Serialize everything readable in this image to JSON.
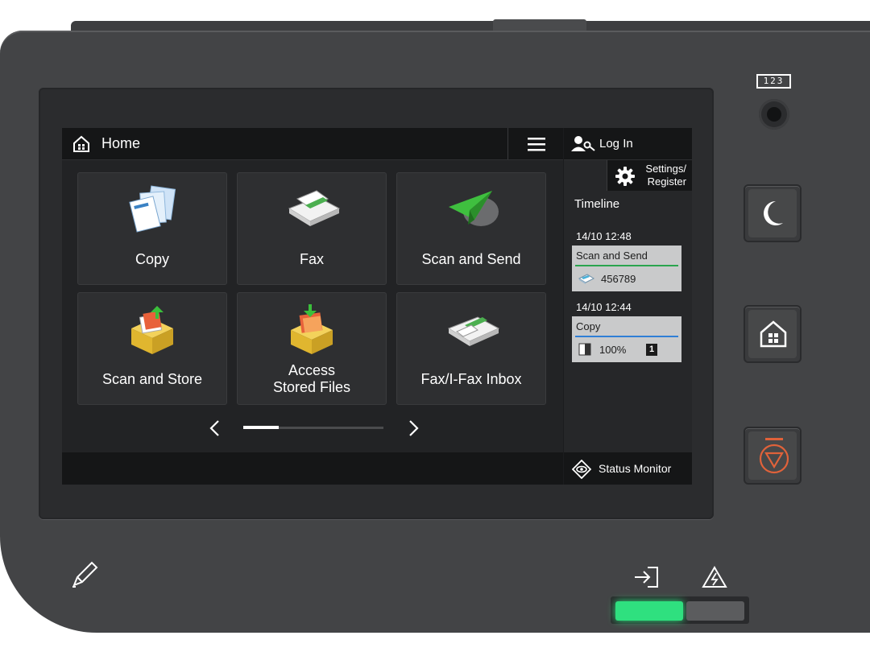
{
  "header": {
    "title": "Home"
  },
  "tiles": [
    {
      "label": "Copy",
      "icon": "copy-icon"
    },
    {
      "label": "Fax",
      "icon": "fax-icon"
    },
    {
      "label": "Scan and Send",
      "icon": "scan-send-icon"
    },
    {
      "label": "Scan and Store",
      "icon": "scan-store-icon"
    },
    {
      "label": "Access\nStored Files",
      "line1": "Access",
      "line2": "Stored Files",
      "icon": "stored-files-icon"
    },
    {
      "label": "Fax/I-Fax Inbox",
      "icon": "fax-inbox-icon"
    }
  ],
  "side_panel": {
    "login_label": "Log In",
    "settings_line1": "Settings/",
    "settings_line2": "Register",
    "timeline_title": "Timeline",
    "jobs": [
      {
        "time": "14/10 12:48",
        "name": "Scan and Send",
        "value": "456789",
        "accent": "#2aa44e"
      },
      {
        "time": "14/10 12:44",
        "name": "Copy",
        "value": "100%",
        "count": "1",
        "accent": "#2f7fd6"
      }
    ],
    "status_monitor_label": "Status Monitor"
  },
  "hardware": {
    "counter_label": "123"
  },
  "colors": {
    "screen_bg": "#222325",
    "device_body": "#434446",
    "stop_accent": "#e0623a",
    "processing_led": "#2fe07f"
  }
}
